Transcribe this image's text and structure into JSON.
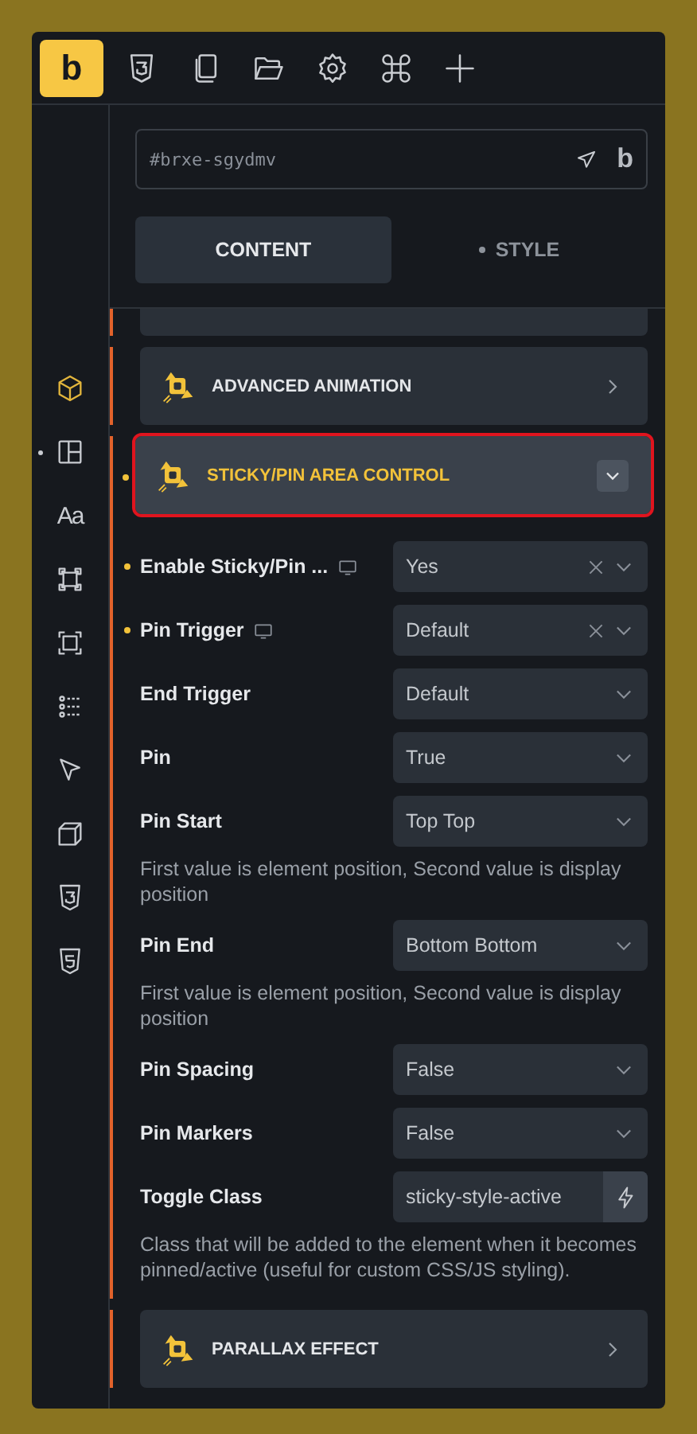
{
  "toolbar": {
    "logo": "b",
    "icons": [
      {
        "kind": "css3"
      },
      {
        "kind": "pages"
      },
      {
        "kind": "folder"
      },
      {
        "kind": "settings"
      },
      {
        "kind": "command"
      },
      {
        "kind": "add"
      }
    ]
  },
  "sidebar": {
    "items": [
      {
        "kind": "cube",
        "selected": true,
        "dot": false
      },
      {
        "kind": "layout",
        "selected": false,
        "dot": true
      },
      {
        "kind": "typography",
        "label": "Aa",
        "selected": false,
        "dot": false
      },
      {
        "kind": "frame",
        "selected": false,
        "dot": false
      },
      {
        "kind": "crop",
        "selected": false,
        "dot": false
      },
      {
        "kind": "list",
        "selected": false,
        "dot": false
      },
      {
        "kind": "pointer",
        "selected": false,
        "dot": false
      },
      {
        "kind": "box3d",
        "selected": false,
        "dot": false
      },
      {
        "kind": "css3",
        "selected": false,
        "dot": false
      },
      {
        "kind": "html5",
        "selected": false,
        "dot": false
      }
    ]
  },
  "selector": {
    "value": "#brxe-sgydmv",
    "badge": "b"
  },
  "tabs": [
    {
      "label": "CONTENT",
      "selected": true,
      "dot": false
    },
    {
      "label": "STYLE",
      "selected": false,
      "dot": true
    }
  ],
  "sections": [
    {
      "title": "ADVANCED ANIMATION",
      "expanded": false,
      "highlighted": false,
      "dot": false
    },
    {
      "title": "STICKY/PIN AREA CONTROL",
      "expanded": true,
      "highlighted": true,
      "dot": true,
      "fields": [
        {
          "kind": "select",
          "label": "Enable Sticky/Pin ...",
          "dot": true,
          "responsive": true,
          "value": "Yes",
          "clearable": true
        },
        {
          "kind": "select",
          "label": "Pin Trigger",
          "dot": true,
          "responsive": true,
          "value": "Default",
          "clearable": true
        },
        {
          "kind": "select",
          "label": "End Trigger",
          "dot": false,
          "responsive": false,
          "value": "Default",
          "clearable": false
        },
        {
          "kind": "select",
          "label": "Pin",
          "dot": false,
          "responsive": false,
          "value": "True",
          "clearable": false
        },
        {
          "kind": "select",
          "label": "Pin Start",
          "dot": false,
          "responsive": false,
          "value": "Top Top",
          "clearable": false,
          "description": "First value is element position, Second value is display position"
        },
        {
          "kind": "select",
          "label": "Pin End",
          "dot": false,
          "responsive": false,
          "value": "Bottom Bottom",
          "clearable": false,
          "description": "First value is element position, Second value is display position"
        },
        {
          "kind": "select",
          "label": "Pin Spacing",
          "dot": false,
          "responsive": false,
          "value": "False",
          "clearable": false
        },
        {
          "kind": "select",
          "label": "Pin Markers",
          "dot": false,
          "responsive": false,
          "value": "False",
          "clearable": false
        },
        {
          "kind": "text",
          "label": "Toggle Class",
          "dot": false,
          "responsive": false,
          "value": "sticky-style-active",
          "description": "Class that will be added to the element when it becomes pinned/active (useful for custom CSS/JS styling)."
        }
      ]
    },
    {
      "title": "PARALLAX EFFECT",
      "expanded": false,
      "highlighted": false,
      "dot": false
    }
  ]
}
